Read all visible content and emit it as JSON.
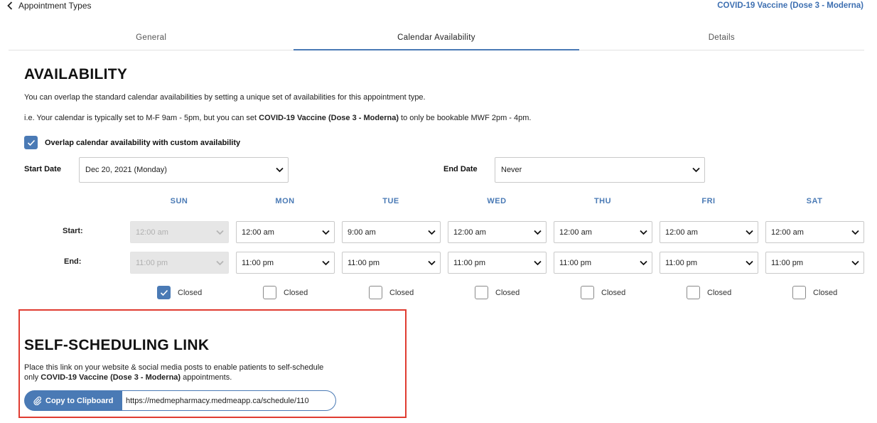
{
  "header": {
    "back_label": "Appointment Types",
    "appointment_name": "COVID-19 Vaccine (Dose 3 - Moderna)"
  },
  "tabs": [
    {
      "label": "General",
      "active": false
    },
    {
      "label": "Calendar Availability",
      "active": true
    },
    {
      "label": "Details",
      "active": false
    }
  ],
  "availability": {
    "title": "AVAILABILITY",
    "description": "You can overlap the standard calendar availabilities by setting a unique set of availabilities for this appointment type.",
    "example_prefix": "i.e. Your calendar is typically set to M-F 9am - 5pm, but you can set ",
    "example_bold": "COVID-19 Vaccine (Dose 3 - Moderna)",
    "example_suffix": " to only be bookable MWF 2pm - 4pm.",
    "overlap_label": "Overlap calendar availability with custom availability",
    "overlap_checked": true,
    "start_date_label": "Start Date",
    "start_date_value": "Dec 20, 2021 (Monday)",
    "end_date_label": "End Date",
    "end_date_value": "Never",
    "start_row_label": "Start:",
    "end_row_label": "End:",
    "days": [
      {
        "name": "SUN",
        "start": "12:00 am",
        "end": "11:00 pm",
        "closed_label": "Closed",
        "closed": true
      },
      {
        "name": "MON",
        "start": "12:00 am",
        "end": "11:00 pm",
        "closed_label": "Closed",
        "closed": false
      },
      {
        "name": "TUE",
        "start": "9:00 am",
        "end": "11:00 pm",
        "closed_label": "Closed",
        "closed": false
      },
      {
        "name": "WED",
        "start": "12:00 am",
        "end": "11:00 pm",
        "closed_label": "Closed",
        "closed": false
      },
      {
        "name": "THU",
        "start": "12:00 am",
        "end": "11:00 pm",
        "closed_label": "Closed",
        "closed": false
      },
      {
        "name": "FRI",
        "start": "12:00 am",
        "end": "11:00 pm",
        "closed_label": "Closed",
        "closed": false
      },
      {
        "name": "SAT",
        "start": "12:00 am",
        "end": "11:00 pm",
        "closed_label": "Closed",
        "closed": false
      }
    ]
  },
  "self_scheduling": {
    "title": "SELF-SCHEDULING LINK",
    "line1": "Place this link on your website & social media posts to enable patients to self-schedule",
    "line2_prefix": "only ",
    "line2_bold": "COVID-19 Vaccine (Dose 3 - Moderna)",
    "line2_suffix": " appointments.",
    "copy_label": "Copy to Clipboard",
    "url": "https://medmepharmacy.medmeapp.ca/schedule/110"
  },
  "colors": {
    "accent": "#4a7ab5",
    "highlight_border": "#e03c31"
  }
}
